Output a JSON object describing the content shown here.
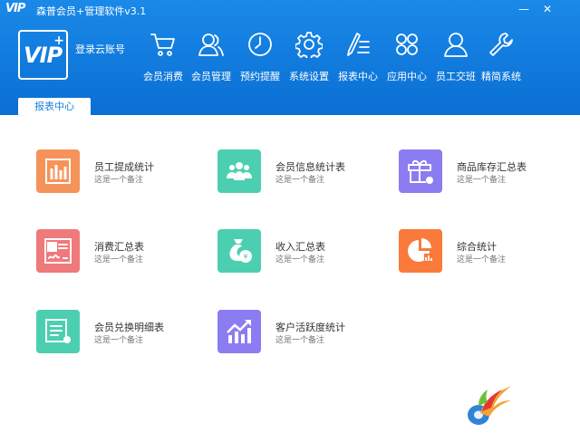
{
  "window": {
    "logo_mini": "VIP",
    "title": "森普会员+管理软件v3.1",
    "minimize": "—",
    "close": "✕"
  },
  "brand": {
    "logo": "VIP",
    "logo_plus": "+",
    "login_label": "登录云账号"
  },
  "nav": [
    {
      "label": "会员消费",
      "icon": "cart-icon"
    },
    {
      "label": "会员管理",
      "icon": "members-icon"
    },
    {
      "label": "预约提醒",
      "icon": "clock-icon"
    },
    {
      "label": "系统设置",
      "icon": "gear-icon"
    },
    {
      "label": "报表中心",
      "icon": "pen-list-icon"
    },
    {
      "label": "应用中心",
      "icon": "apps-grid-icon"
    },
    {
      "label": "员工交班",
      "icon": "person-icon"
    },
    {
      "label": "精简系统",
      "icon": "wrench-icon"
    }
  ],
  "active_tab": "报表中心",
  "reports": [
    {
      "title": "员工提成统计",
      "note": "这是一个备注",
      "color": "#f5935a",
      "icon": "bar-chart-icon"
    },
    {
      "title": "会员信息统计表",
      "note": "这是一个备注",
      "color": "#4ccfb0",
      "icon": "group-icon"
    },
    {
      "title": "商品库存汇总表",
      "note": "这是一个备注",
      "color": "#8b7cf2",
      "icon": "gift-box-icon"
    },
    {
      "title": "消费汇总表",
      "note": "这是一个备注",
      "color": "#f0797b",
      "icon": "certificate-icon"
    },
    {
      "title": "收入汇总表",
      "note": "这是一个备注",
      "color": "#4ccfb0",
      "icon": "money-bag-icon"
    },
    {
      "title": "综合统计",
      "note": "这是一个备注",
      "color": "#f97a3a",
      "icon": "pie-chart-icon"
    },
    {
      "title": "会员兑换明细表",
      "note": "这是一个备注",
      "color": "#4ccfb0",
      "icon": "document-icon"
    },
    {
      "title": "客户活跃度统计",
      "note": "这是一个备注",
      "color": "#8b7cf2",
      "icon": "trend-chart-icon"
    }
  ]
}
